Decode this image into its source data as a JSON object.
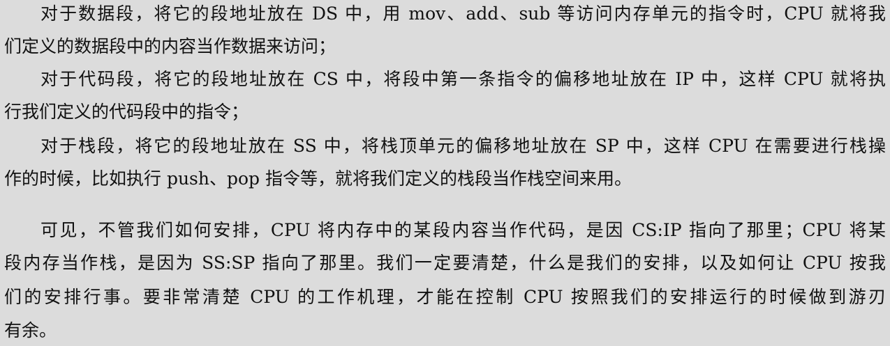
{
  "paragraphs": [
    {
      "lines": [
        "对于数据段，将它的段地址放在 DS 中，用 mov、add、sub 等访问内存单元的指令时，CPU 就将我",
        "们定义的数据段中的内容当作数据来访问；"
      ]
    },
    {
      "lines": [
        "对于代码段，将它的段地址放在 CS 中，将段中第一条指令的偏移地址放在 IP 中，这样 CPU 就将执",
        "行我们定义的代码段中的指令；"
      ]
    },
    {
      "lines": [
        "对于栈段，将它的段地址放在 SS 中，将栈顶单元的偏移地址放在 SP 中，这样 CPU 在需要进行栈操",
        "作的时候，比如执行 push、pop 指令等，就将我们定义的栈段当作栈空间来用。"
      ]
    },
    {
      "lines": [
        "可见，不管我们如何安排，CPU 将内存中的某段内容当作代码，是因 CS:IP 指向了那里；CPU 将某",
        "段内存当作栈，是因为 SS:SP 指向了那里。我们一定要清楚，什么是我们的安排，以及如何让 CPU 按我",
        "们的安排行事。要非常清楚 CPU 的工作机理，才能在控制 CPU 按照我们的安排运行的时候做到游刃",
        "有余。"
      ]
    }
  ]
}
